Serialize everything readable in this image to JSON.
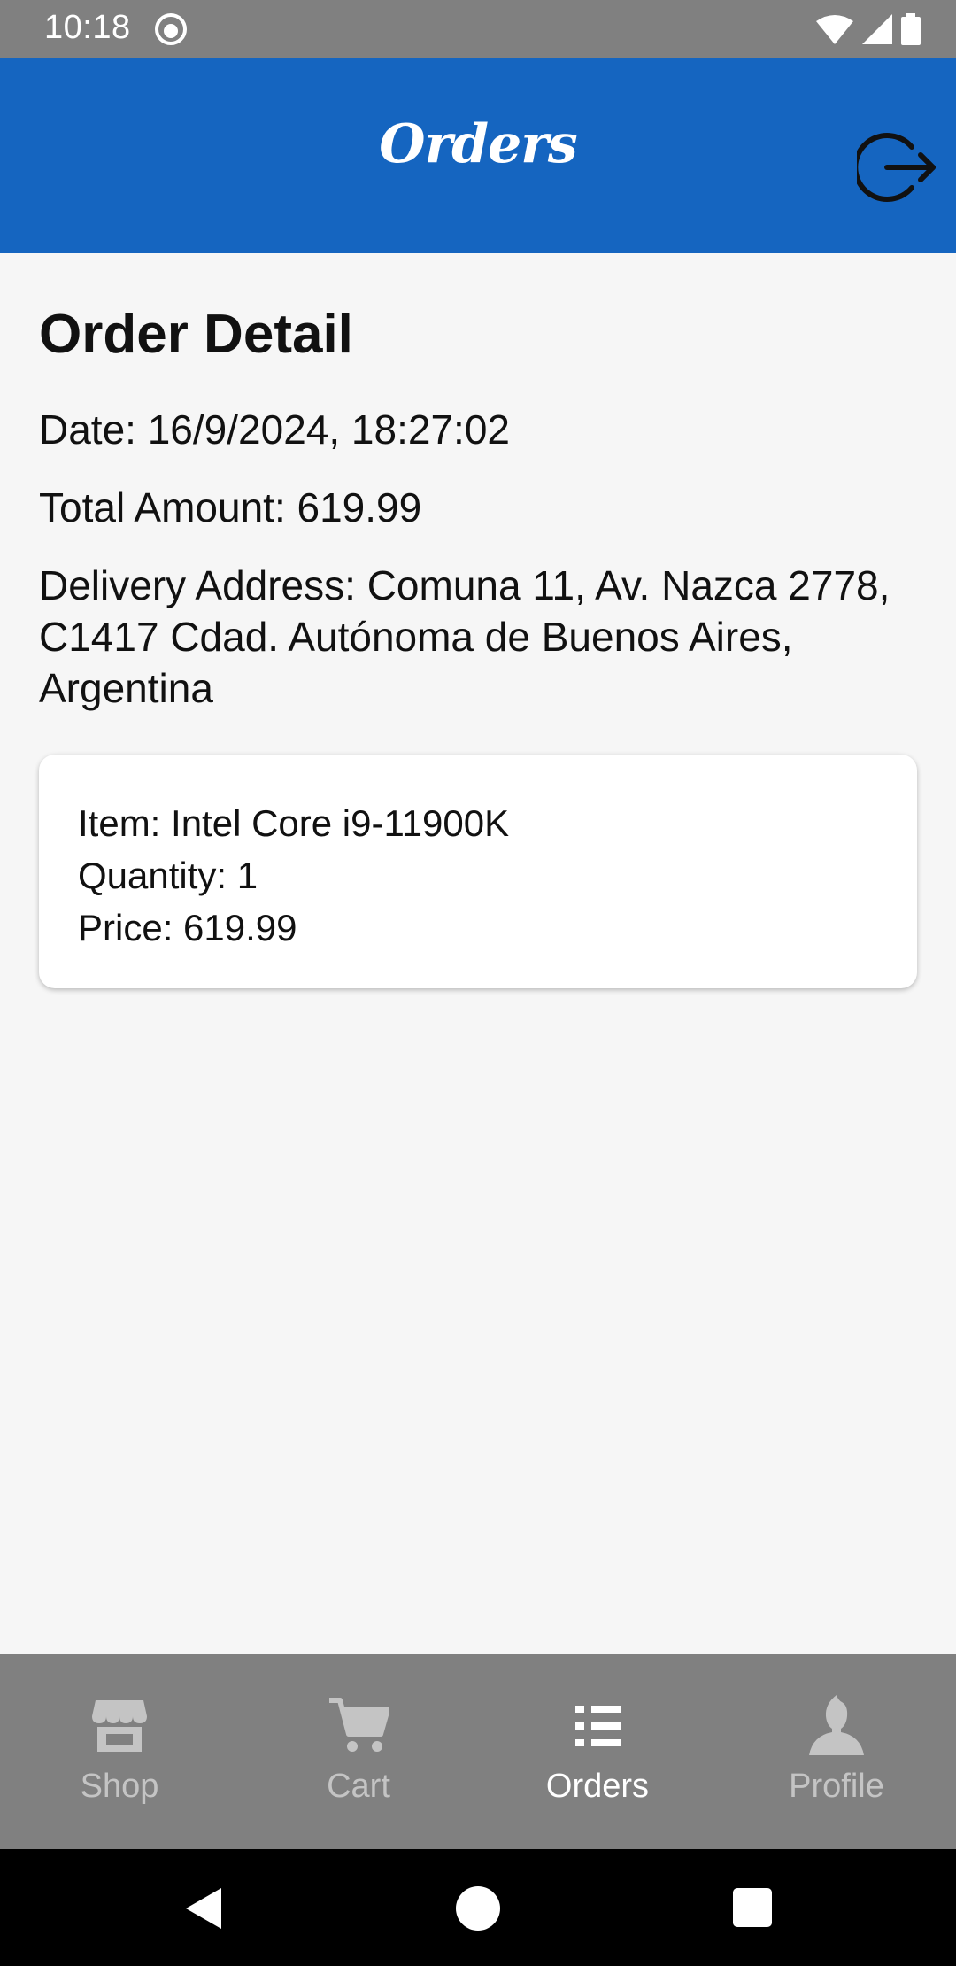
{
  "status_bar": {
    "time": "10:18"
  },
  "header": {
    "title": "Orders",
    "logout_icon": "logout-icon"
  },
  "order_detail": {
    "title": "Order Detail",
    "date": "Date: 16/9/2024, 18:27:02",
    "total": "Total Amount: 619.99",
    "address": "Delivery Address: Comuna 11, Av. Nazca 2778, C1417 Cdad. Autónoma de Buenos Aires, Argentina",
    "items": [
      {
        "item": "Item: Intel Core i9-11900K",
        "quantity": "Quantity: 1",
        "price": "Price: 619.99"
      }
    ]
  },
  "tabs": [
    {
      "label": "Shop",
      "icon": "shop-icon",
      "active": false
    },
    {
      "label": "Cart",
      "icon": "cart-icon",
      "active": false
    },
    {
      "label": "Orders",
      "icon": "list-icon",
      "active": true
    },
    {
      "label": "Profile",
      "icon": "person-icon",
      "active": false
    }
  ],
  "colors": {
    "header": "#1565c0",
    "tab_bar": "#808080",
    "background": "#f6f6f6",
    "tab_active": "#ffffff",
    "tab_inactive": "#c4c4c4"
  }
}
